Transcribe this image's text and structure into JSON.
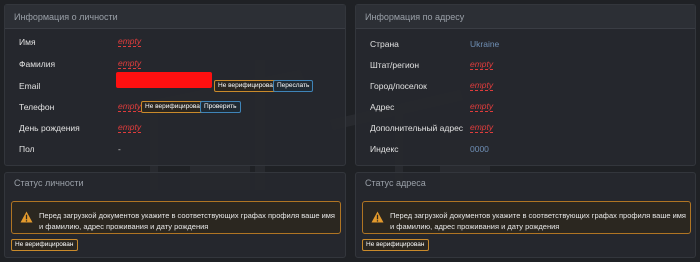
{
  "personal": {
    "title": "Информация о личности",
    "rows": [
      {
        "label": "Имя",
        "value": "empty"
      },
      {
        "label": "Фамилия",
        "value": "empty"
      },
      {
        "label": "Email",
        "value": ""
      },
      {
        "label": "Телефон",
        "value": "empty"
      },
      {
        "label": "День рождения",
        "value": "empty"
      },
      {
        "label": "Пол",
        "value": "-"
      }
    ],
    "email_badge": "Не верифицирован",
    "email_action": "Переслать",
    "phone_badge": "Не верифицирован",
    "phone_action": "Проверить"
  },
  "address": {
    "title": "Информация по адресу",
    "rows": [
      {
        "label": "Страна",
        "value": "Ukraine"
      },
      {
        "label": "Штат/регион",
        "value": "empty"
      },
      {
        "label": "Город/поселок",
        "value": "empty"
      },
      {
        "label": "Адрес",
        "value": "empty"
      },
      {
        "label": "Дополнительный адрес",
        "value": "empty"
      },
      {
        "label": "Индекс",
        "value": "0000"
      }
    ]
  },
  "personal_status": {
    "title": "Статус личности",
    "alert_line1": "Перед загрузкой документов укажите в соответствующих графах профиля ваше имя",
    "alert_line2": "и фамилию, адрес проживания и дату рождения",
    "badge": "Не верифицирован"
  },
  "address_status": {
    "title": "Статус адреса",
    "alert_line1": "Перед загрузкой документов укажите в соответствующих графах профиля ваше имя",
    "alert_line2": "и фамилию, адрес проживания и дату рождения",
    "badge": "Не верифицирован"
  },
  "colors": {
    "background": "#1f2125",
    "panel": "#26282e",
    "empty_red": "#e03c3c",
    "warning_orange": "#c98a2b",
    "info_blue": "#3f84b8",
    "value_blue": "#6f8fb5"
  }
}
